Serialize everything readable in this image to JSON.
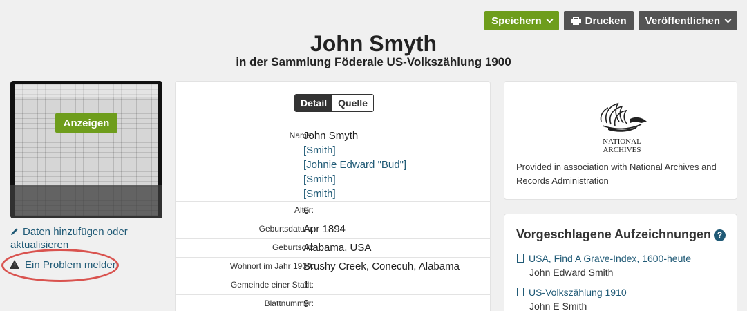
{
  "actions": {
    "save": "Speichern",
    "print": "Drucken",
    "publish": "Veröffentlichen"
  },
  "header": {
    "name": "John Smyth",
    "collection": "in der Sammlung Föderale US-Volkszählung 1900"
  },
  "image": {
    "view_label": "Anzeigen"
  },
  "links": {
    "edit": "Daten hinzufügen oder aktualisieren",
    "report": "Ein Problem melden"
  },
  "tabs": {
    "detail": "Detail",
    "source": "Quelle"
  },
  "details": {
    "name_label": "Name:",
    "name_value": "John Smyth",
    "name_alts": [
      "[Smith]",
      "[Johnie Edward \"Bud\"]",
      "[Smith]",
      "[Smith]"
    ],
    "rows": [
      {
        "label": "Alter:",
        "value": "6"
      },
      {
        "label": "Geburtsdatum:",
        "value": "Apr 1894"
      },
      {
        "label": "Geburtsort:",
        "value": "Alabama, USA"
      },
      {
        "label": "Wohnort im Jahr 1900:",
        "value": "Brushy Creek, Conecuh, Alabama"
      },
      {
        "label": "Gemeinde einer Stadt:",
        "value": "1"
      },
      {
        "label": "Blattnummer:",
        "value": "9"
      }
    ]
  },
  "provider": {
    "logo_text": [
      "NATIONAL",
      "ARCHIVES"
    ],
    "text": "Provided in association with National Archives and Records Administration"
  },
  "suggested": {
    "title": "Vorgeschlagene Aufzeichnungen",
    "help": "?",
    "items": [
      {
        "title": "USA, Find A Grave-Index, 1600-heute",
        "subject": "John Edward Smith"
      },
      {
        "title": "US-Volkszählung 1910",
        "subject": "John E Smith"
      }
    ]
  },
  "colors": {
    "accent": "#6e9d1c",
    "link": "#205a76",
    "button_dark": "#545454",
    "highlight": "#d9534f"
  }
}
